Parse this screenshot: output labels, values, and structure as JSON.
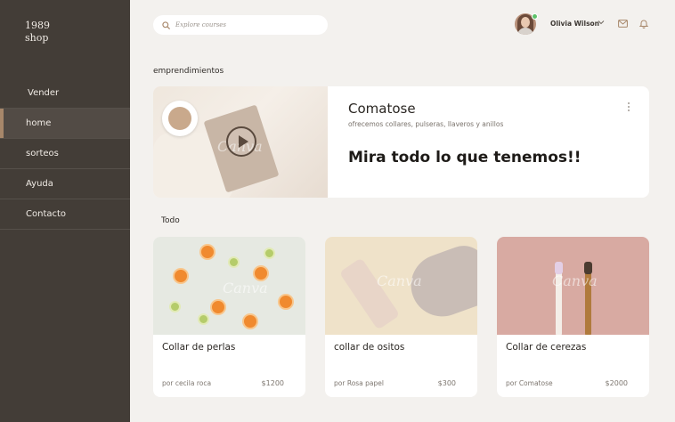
{
  "sidebar": {
    "logo": {
      "line1": "1989",
      "line2": "shop"
    },
    "items": [
      {
        "label": "Vender"
      },
      {
        "label": "home"
      },
      {
        "label": "sorteos"
      },
      {
        "label": "Ayuda"
      },
      {
        "label": "Contacto"
      }
    ]
  },
  "header": {
    "search_placeholder": "Explore courses",
    "user_name": "Olivia Wilson"
  },
  "main": {
    "section1_title": "emprendimientos",
    "hero": {
      "title": "Comatose",
      "subtitle": "ofrecemos collares, pulseras, llaveros y anillos",
      "cta": "Mira todo lo que tenemos!!",
      "watermark": "Canva"
    },
    "section2_title": "Todo",
    "cards": [
      {
        "title": "Collar de perlas",
        "by": "por cecila roca",
        "price": "$1200",
        "watermark": "Canva"
      },
      {
        "title": "collar de ositos",
        "by": "por Rosa papel",
        "price": "$300",
        "watermark": "Canva"
      },
      {
        "title": "Collar de cerezas",
        "by": "por Comatose",
        "price": "$2000",
        "watermark": "Canva"
      }
    ]
  },
  "colors": {
    "sidebar_bg": "#433d37",
    "accent": "#a7876a",
    "page_bg": "#f3f1ee",
    "online": "#5dc26a"
  },
  "icons": [
    "search-icon",
    "chevron-down-icon",
    "mail-icon",
    "bell-icon",
    "more-vertical-icon",
    "play-icon"
  ]
}
